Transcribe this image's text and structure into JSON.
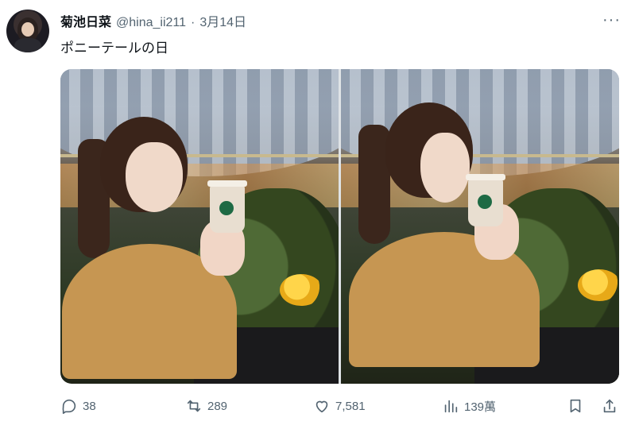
{
  "post": {
    "author_name": "菊池日菜",
    "handle": "@hina_ii211",
    "separator": "·",
    "date": "3月14日",
    "text": "ポニーテールの日",
    "more_label": "···"
  },
  "actions": {
    "replies": "38",
    "reposts": "289",
    "likes": "7,581",
    "views": "139萬"
  },
  "icons": [
    "reply-icon",
    "repost-icon",
    "like-icon",
    "views-icon",
    "bookmark-icon",
    "share-icon"
  ],
  "colors": {
    "text": "#0f1419",
    "muted": "#536471",
    "background": "#ffffff"
  }
}
